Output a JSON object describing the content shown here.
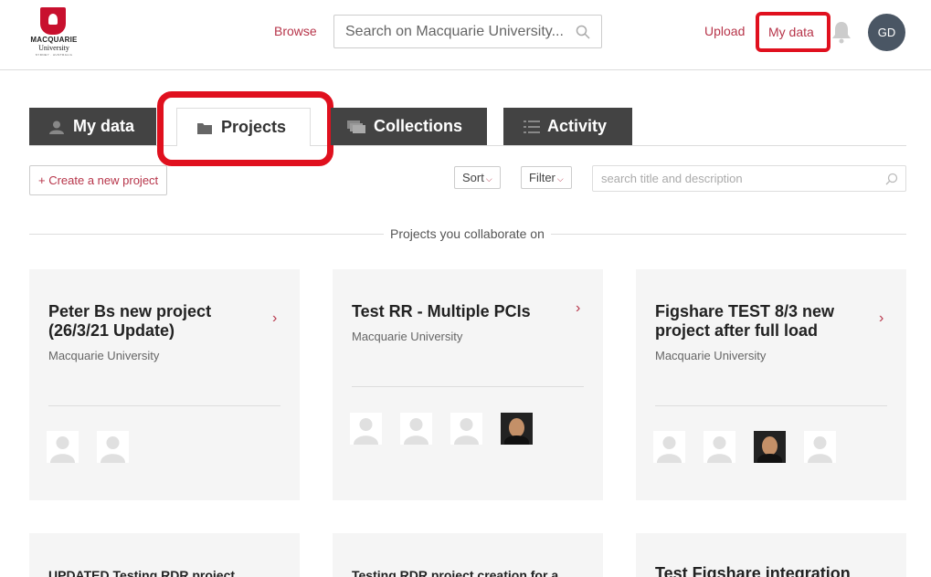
{
  "header": {
    "logo": {
      "line1": "MACQUARIE",
      "line2": "University",
      "line3": "SYDNEY · AUSTRALIA"
    },
    "browse": "Browse",
    "search_placeholder": "Search on Macquarie University...",
    "upload": "Upload",
    "my_data": "My data",
    "avatar_initials": "GD",
    "icons": {
      "search": "magnifier-icon",
      "notifications": "bell-icon"
    },
    "highlight_color": "#e0101e"
  },
  "tabs": [
    {
      "label": "My data",
      "icon": "user-icon",
      "active": false
    },
    {
      "label": "Projects",
      "icon": "folder-icon",
      "active": true
    },
    {
      "label": "Collections",
      "icon": "collections-icon",
      "active": false
    },
    {
      "label": "Activity",
      "icon": "list-icon",
      "active": false
    }
  ],
  "toolbar": {
    "create_project": "+ Create a new project",
    "sort": "Sort",
    "filter": "Filter",
    "search_placeholder": "search title and description"
  },
  "section_label": "Projects you collaborate on",
  "projects": [
    {
      "title": "Peter Bs new project (26/3/21 Update)",
      "org": "Macquarie University",
      "members": [
        "placeholder",
        "placeholder"
      ]
    },
    {
      "title": "Test RR - Multiple PCIs",
      "org": "Macquarie University",
      "members": [
        "placeholder",
        "placeholder",
        "placeholder",
        "photo"
      ]
    },
    {
      "title": "Figshare TEST 8/3 new project after full load",
      "org": "Macquarie University",
      "members": [
        "placeholder",
        "placeholder",
        "photo",
        "placeholder"
      ]
    },
    {
      "title": "UPDATED Testing RDR project"
    },
    {
      "title": "Testing RDR project creation for a"
    },
    {
      "title": "Test Figshare integration"
    }
  ],
  "colors": {
    "accent": "#b7354a",
    "tab_dark": "#434343",
    "card_bg": "#f5f5f5"
  }
}
